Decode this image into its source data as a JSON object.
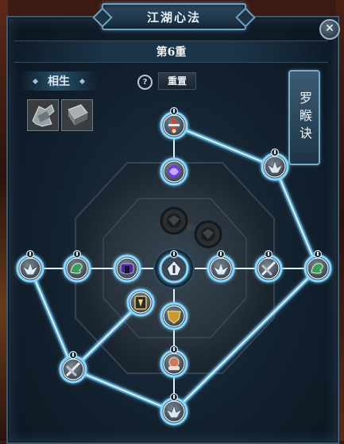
{
  "window": {
    "title": "江湖心法",
    "close_symbol": "✕"
  },
  "level": "第6重",
  "tab": "相生",
  "reset": {
    "icon_symbol": "?",
    "label": "重置"
  },
  "side_button": "罗睺诀",
  "item_slots": [
    {
      "icon": "armor-bundle-icon"
    },
    {
      "icon": "scroll-book-icon"
    }
  ],
  "colors": {
    "link_glow": "#6fd0ff",
    "link_core": "#d9f4ff",
    "node_ring": "#e8f4fb",
    "node_active_ring": "#86d6ff",
    "locked_node": "#2a2f33"
  },
  "nodes": [
    {
      "id": "n-top",
      "icon": "warrior-sword-icon",
      "state": "active",
      "badge": true
    },
    {
      "id": "n-purple",
      "icon": "purple-orb-icon",
      "state": "active",
      "badge": false
    },
    {
      "id": "n-locked-1",
      "icon": "dark-mask-icon",
      "state": "locked",
      "badge": false
    },
    {
      "id": "n-locked-2",
      "icon": "dark-mask-icon",
      "state": "locked",
      "badge": false
    },
    {
      "id": "n-right-upper",
      "icon": "winged-helm-icon",
      "state": "active",
      "badge": true
    },
    {
      "id": "n-left-end",
      "icon": "winged-helm-icon",
      "state": "active",
      "badge": true
    },
    {
      "id": "n-left-2",
      "icon": "green-dragon-icon",
      "state": "active",
      "badge": true
    },
    {
      "id": "n-left-3",
      "icon": "purple-gate-icon",
      "state": "active",
      "badge": false
    },
    {
      "id": "n-center",
      "icon": "center-helm-icon",
      "state": "center",
      "badge": true
    },
    {
      "id": "n-right-1",
      "icon": "winged-helm-icon",
      "state": "active",
      "badge": true
    },
    {
      "id": "n-right-2",
      "icon": "crossed-blades-icon",
      "state": "active",
      "badge": true
    },
    {
      "id": "n-right-end",
      "icon": "green-dragon-icon",
      "state": "active",
      "badge": true
    },
    {
      "id": "n-mid-left",
      "icon": "gold-rune-icon",
      "state": "active",
      "badge": false
    },
    {
      "id": "n-gold",
      "icon": "gold-crest-icon",
      "state": "active",
      "badge": false
    },
    {
      "id": "n-lower-left",
      "icon": "crossed-blades-icon",
      "state": "active",
      "badge": true
    },
    {
      "id": "n-lower",
      "icon": "fist-scroll-icon",
      "state": "active",
      "badge": true
    },
    {
      "id": "n-bottom",
      "icon": "winged-helm-icon",
      "state": "active",
      "badge": true
    }
  ],
  "links": [
    [
      "n-top",
      "n-purple"
    ],
    [
      "n-top",
      "n-right-upper"
    ],
    [
      "n-right-upper",
      "n-right-end"
    ],
    [
      "n-left-end",
      "n-left-2"
    ],
    [
      "n-left-2",
      "n-left-3"
    ],
    [
      "n-left-3",
      "n-center"
    ],
    [
      "n-center",
      "n-right-1"
    ],
    [
      "n-right-1",
      "n-right-2"
    ],
    [
      "n-right-2",
      "n-right-end"
    ],
    [
      "n-left-end",
      "n-lower-left"
    ],
    [
      "n-lower-left",
      "n-mid-left"
    ],
    [
      "n-center",
      "n-gold"
    ],
    [
      "n-gold",
      "n-lower"
    ],
    [
      "n-lower",
      "n-bottom"
    ],
    [
      "n-lower-left",
      "n-bottom"
    ],
    [
      "n-right-end",
      "n-bottom"
    ]
  ],
  "locked_links": [
    [
      "n-locked-1",
      "n-locked-2"
    ]
  ]
}
